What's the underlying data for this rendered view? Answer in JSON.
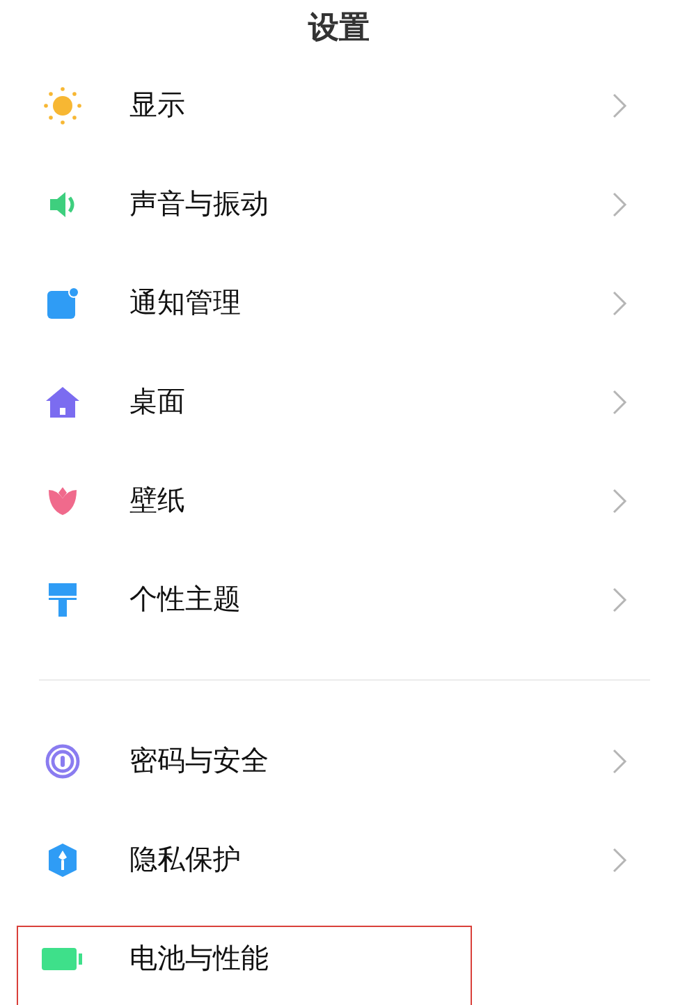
{
  "title": "设置",
  "groups": [
    {
      "items": [
        {
          "label": "显示",
          "kind": "sun",
          "chevron": true,
          "highlighted": false
        },
        {
          "label": "声音与振动",
          "kind": "speaker",
          "chevron": true,
          "highlighted": false
        },
        {
          "label": "通知管理",
          "kind": "notification",
          "chevron": true,
          "highlighted": false
        },
        {
          "label": "桌面",
          "kind": "home",
          "chevron": true,
          "highlighted": false
        },
        {
          "label": "壁纸",
          "kind": "tulip",
          "chevron": true,
          "highlighted": false
        },
        {
          "label": "个性主题",
          "kind": "brush",
          "chevron": true,
          "highlighted": false
        }
      ]
    },
    {
      "items": [
        {
          "label": "密码与安全",
          "kind": "fingerprint",
          "chevron": true,
          "highlighted": false
        },
        {
          "label": "隐私保护",
          "kind": "shield",
          "chevron": true,
          "highlighted": false
        },
        {
          "label": "电池与性能",
          "kind": "battery",
          "chevron": false,
          "highlighted": true
        }
      ]
    }
  ]
}
